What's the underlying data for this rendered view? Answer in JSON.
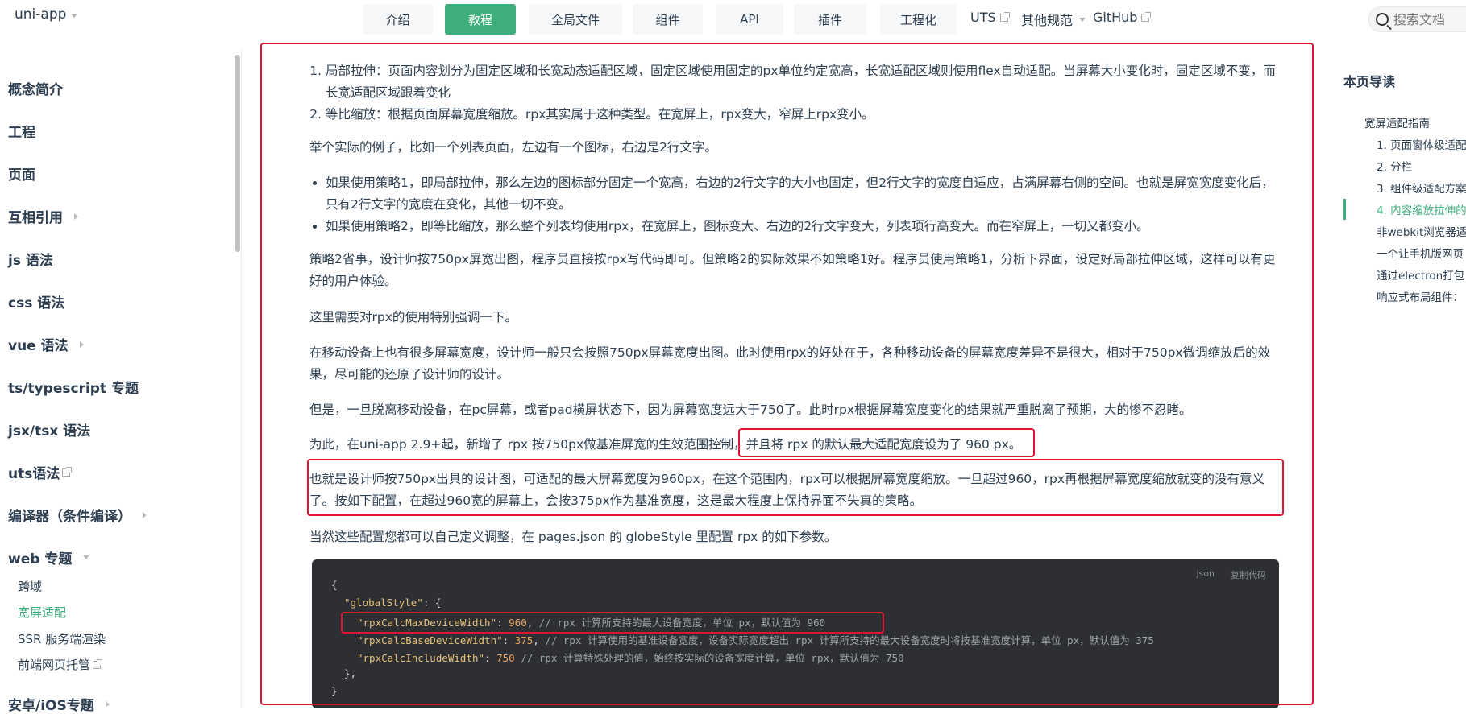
{
  "brand": {
    "name": "uni-app"
  },
  "nav": {
    "buttons": [
      "介绍",
      "教程",
      "全局文件",
      "组件",
      "API",
      "插件",
      "工程化"
    ],
    "links": [
      "UTS",
      "其他规范",
      "GitHub"
    ],
    "search_placeholder": "搜索文档"
  },
  "sidebar": {
    "items": [
      "概念简介",
      "工程",
      "页面",
      "互相引用",
      "js 语法",
      "css 语法",
      "vue 语法",
      "ts/typescript 专题",
      "jsx/tsx 语法",
      "uts语法",
      "编译器（条件编译）",
      "web 专题",
      "安卓/iOS专题"
    ],
    "subitems": [
      "跨域",
      "宽屏适配",
      "SSR 服务端渲染",
      "前端网页托管"
    ]
  },
  "content": {
    "ol_items": [
      "局部拉伸：页面内容划分为固定区域和长宽动态适配区域，固定区域使用固定的px单位约定宽高，长宽适配区域则使用flex自动适配。当屏幕大小变化时，固定区域不变，而长宽适配区域跟着变化",
      "等比缩放：根据页面屏幕宽度缩放。rpx其实属于这种类型。在宽屏上，rpx变大，窄屏上rpx变小。"
    ],
    "p_example": "举个实际的例子，比如一个列表页面，左边有一个图标，右边是2行文字。",
    "ul_items": [
      "如果使用策略1，即局部拉伸，那么左边的图标部分固定一个宽高，右边的2行文字的大小也固定，但2行文字的宽度自适应，占满屏幕右侧的空间。也就是屏宽宽度变化后，只有2行文字的宽度在变化，其他一切不变。",
      "如果使用策略2，即等比缩放，那么整个列表均使用rpx，在宽屏上，图标变大、右边的2行文字变大，列表项行高变大。而在窄屏上，一切又都变小。"
    ],
    "p_strategy": "策略2省事，设计师按750px屏宽出图，程序员直接按rpx写代码即可。但策略2的实际效果不如策略1好。程序员使用策略1，分析下界面，设定好局部拉伸区域，这样可以有更好的用户体验。",
    "p_emphasis": "这里需要对rpx的使用特别强调一下。",
    "p_mobile": "在移动设备上也有很多屏幕宽度，设计师一般只会按照750px屏幕宽度出图。此时使用rpx的好处在于，各种移动设备的屏幕宽度差异不是很大，相对于750px微调缩放后的效果，尽可能的还原了设计师的设计。",
    "p_pc": "但是，一旦脱离移动设备，在pc屏幕，或者pad横屏状态下，因为屏幕宽度远大于750了。此时rpx根据屏幕宽度变化的结果就严重脱离了预期，大的惨不忍睹。",
    "p_29_a": "为此，在uni-app 2.9+起，新增了 rpx 按750px做基准屏宽的生效范围控制，",
    "p_29_b": "并且将 rpx 的默认最大适配宽度设为了 960 px。",
    "p_designer": "也就是设计师按750px出具的设计图，可适配的最大屏幕宽度为960px，在这个范围内，rpx可以根据屏幕宽度缩放。一旦超过960，rpx再根据屏幕宽度缩放就变的没有意义了。按如下配置，在超过960宽的屏幕上，会按375px作为基准宽度，这是最大程度上保持界面不失真的策略。",
    "p_config": "当然这些配置您都可以自己定义调整，在 pages.json 的 globeStyle 里配置 rpx 的如下参数。"
  },
  "code": {
    "lang": "json",
    "copy": "复制代码",
    "open_brace": "{",
    "global_key": "\"globalStyle\"",
    "global_open": ": {",
    "line1_key": "\"rpxCalcMaxDeviceWidth\"",
    "line1_val": "960",
    "line1_comment": "// rpx 计算所支持的最大设备宽度，单位 px，默认值为 960",
    "line2_key": "\"rpxCalcBaseDeviceWidth\"",
    "line2_val": "375",
    "line2_comment": "// rpx 计算使用的基准设备宽度，设备实际宽度超出 rpx 计算所支持的最大设备宽度时将按基准宽度计算，单位 px，默认值为 375",
    "line3_key": "\"rpxCalcIncludeWidth\"",
    "line3_val": "750",
    "line3_comment": "// rpx 计算特殊处理的值，始终按实际的设备宽度计算，单位 rpx，默认值为 750",
    "inner_close": "},",
    "close_brace": "}"
  },
  "toc": {
    "title": "本页导读",
    "items": [
      "宽屏适配指南",
      "1. 页面窗体级适配",
      "2. 分栏",
      "3. 组件级适配方案",
      "4. 内容缩放拉伸的",
      "非webkit浏览器适",
      "一个让手机版网页",
      "通过electron打包",
      "响应式布局组件："
    ]
  },
  "colors": {
    "accent": "#3eaf7c",
    "highlight": "#e0152f",
    "code_bg": "#2d2f33"
  }
}
